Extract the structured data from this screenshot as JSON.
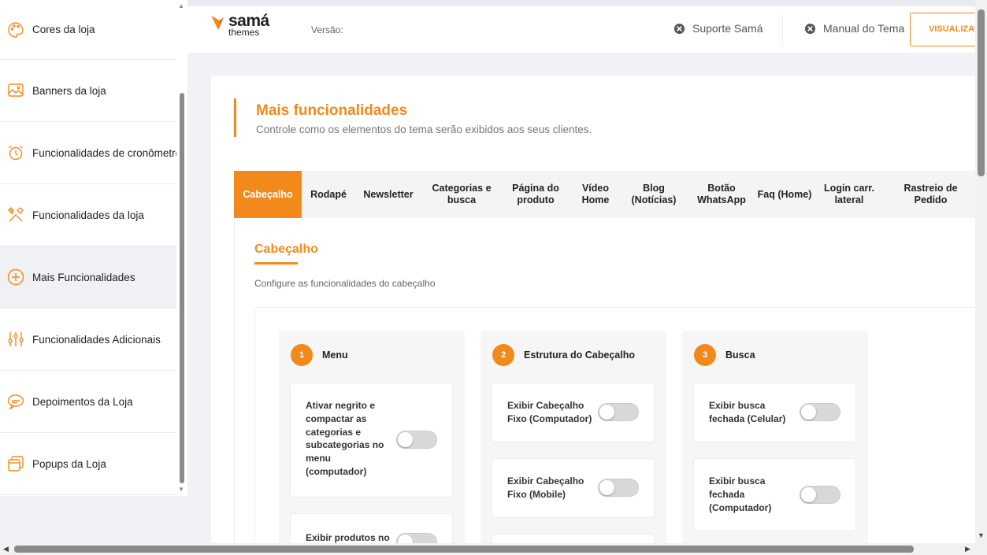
{
  "sidebar": {
    "items": [
      {
        "label": "Cores da loja",
        "icon": "palette-icon"
      },
      {
        "label": "Banners da loja",
        "icon": "image-icon"
      },
      {
        "label": "Funcionalidades de cronômetro",
        "icon": "alarm-clock-icon"
      },
      {
        "label": "Funcionalidades da loja",
        "icon": "tools-icon"
      },
      {
        "label": "Mais Funcionalidades",
        "icon": "plus-circle-icon",
        "active": true
      },
      {
        "label": "Funcionalidades Adicionais",
        "icon": "sliders-icon"
      },
      {
        "label": "Depoimentos da Loja",
        "icon": "chat-icon"
      },
      {
        "label": "Popups da Loja",
        "icon": "popup-icon"
      }
    ]
  },
  "header": {
    "logo_samma": "samá",
    "logo_themes": "themes",
    "version_label": "Versão:",
    "support_label": "Suporte Samá",
    "manual_label": "Manual do Tema",
    "visualize_label": "VISUALIZAR"
  },
  "main": {
    "title": "Mais funcionalidades",
    "subtitle": "Controle como os elementos do tema serão exibidos aos seus clientes.",
    "tabs": [
      {
        "label": "Cabeçalho",
        "active": true
      },
      {
        "label": "Rodapé"
      },
      {
        "label": "Newsletter"
      },
      {
        "label": "Categorias e busca"
      },
      {
        "label": "Página do produto"
      },
      {
        "label": "Vídeo Home"
      },
      {
        "label": "Blog (Notícias)"
      },
      {
        "label": "Botão WhatsApp"
      },
      {
        "label": "Faq (Home)"
      },
      {
        "label": "Login carr. lateral"
      },
      {
        "label": "Rastreio de Pedido"
      }
    ],
    "section_title": "Cabeçalho",
    "section_subtitle": "Configure as funcionalidades do cabeçalho",
    "columns": [
      {
        "number": "1",
        "title": "Menu",
        "options": [
          {
            "label": "Ativar negrito e compactar as categorias e subcategorias no menu (computador)",
            "enabled": false
          },
          {
            "label": "Exibir produtos no",
            "enabled": false
          }
        ]
      },
      {
        "number": "2",
        "title": "Estrutura do Cabeçalho",
        "options": [
          {
            "label": "Exibir Cabeçalho Fixo (Computador)",
            "enabled": false
          },
          {
            "label": "Exibir Cabeçalho Fixo (Mobile)",
            "enabled": false
          }
        ]
      },
      {
        "number": "3",
        "title": "Busca",
        "options": [
          {
            "label": "Exibir busca fechada (Celular)",
            "enabled": false
          },
          {
            "label": "Exibir busca fechada (Computador)",
            "enabled": false
          }
        ]
      }
    ]
  },
  "colors": {
    "accent": "#f28a1b"
  }
}
